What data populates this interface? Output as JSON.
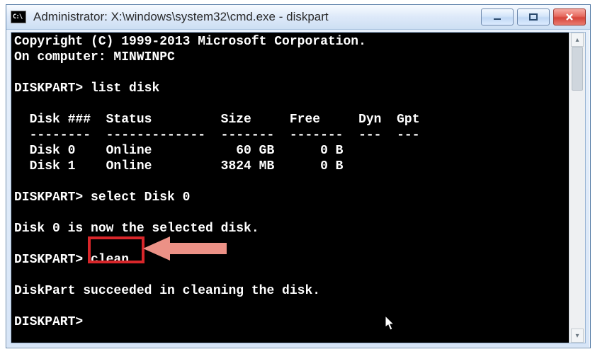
{
  "window": {
    "icon_label": "C:\\",
    "title": "Administrator: X:\\windows\\system32\\cmd.exe - diskpart"
  },
  "scrollbar": {
    "up": "▴",
    "down": "▾"
  },
  "console": {
    "copyright": "Copyright (C) 1999-2013 Microsoft Corporation.",
    "computer_line": "On computer: MINWINPC",
    "prompt": "DISKPART>",
    "cmd_list": "list disk",
    "cmd_select": "select Disk 0",
    "cmd_clean": "clean",
    "msg_selected": "Disk 0 is now the selected disk.",
    "msg_clean_ok": "DiskPart succeeded in cleaning the disk.",
    "table": {
      "header": "  Disk ###  Status         Size     Free     Dyn  Gpt",
      "divider": "  --------  -------------  -------  -------  ---  ---",
      "rows": [
        "  Disk 0    Online           60 GB      0 B",
        "  Disk 1    Online         3824 MB      0 B"
      ]
    }
  },
  "annotations": {
    "highlight_target": "clean-command",
    "arrow_color": "#ec9186"
  }
}
